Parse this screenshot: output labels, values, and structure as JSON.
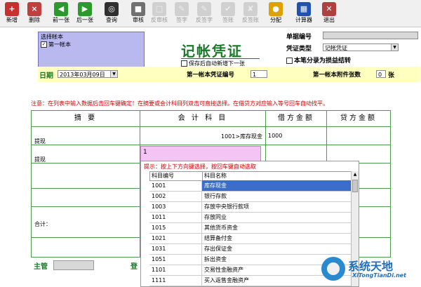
{
  "toolbar": {
    "buttons": [
      {
        "label": "新增",
        "icon": "new-doc-icon",
        "color": "#c83030",
        "enabled": true
      },
      {
        "label": "删除",
        "icon": "delete-icon",
        "color": "#c04040",
        "enabled": true
      },
      {
        "label": "前一张",
        "icon": "arrow-left-icon",
        "color": "#2a9a2a",
        "enabled": true
      },
      {
        "label": "后一张",
        "icon": "arrow-right-icon",
        "color": "#2a9a2a",
        "enabled": true
      },
      {
        "label": "查询",
        "icon": "binoculars-icon",
        "color": "#303030",
        "enabled": true
      },
      {
        "label": "审核",
        "icon": "lock-icon",
        "color": "#707070",
        "enabled": true
      },
      {
        "label": "反审核",
        "icon": "unlock-icon",
        "color": "#c0c0c0",
        "enabled": false
      },
      {
        "label": "签字",
        "icon": "sign-icon",
        "color": "#c0c0c0",
        "enabled": false
      },
      {
        "label": "反签字",
        "icon": "unsign-icon",
        "color": "#c0c0c0",
        "enabled": false
      },
      {
        "label": "签账",
        "icon": "post-icon",
        "color": "#c0c0c0",
        "enabled": false
      },
      {
        "label": "反签账",
        "icon": "unpost-icon",
        "color": "#c0c0c0",
        "enabled": false
      },
      {
        "label": "分配",
        "icon": "pie-icon",
        "color": "#e0a000",
        "enabled": true
      },
      {
        "label": "计算器",
        "icon": "calculator-icon",
        "color": "#2050b0",
        "enabled": true
      },
      {
        "label": "退出",
        "icon": "exit-icon",
        "color": "#b04040",
        "enabled": true
      }
    ]
  },
  "account_box": {
    "title": "选择帐本",
    "item": "第一帐本",
    "checked": "✓"
  },
  "title": "记帐凭证",
  "auto_add_label": "保存后自动新增下一张",
  "doc_number_label": "单据编号",
  "voucher_type_label": "凭证类型",
  "voucher_type_value": "记帐凭证",
  "profit_loss_label": "本笔分录为损益结转",
  "date_label": "日期",
  "date_value": "2013年03月09日",
  "voucher_no_label": "第一帐本凭证编号",
  "voucher_no_value": "1",
  "attachments_label": "第一帐本附件张数",
  "attachments_value": "0",
  "attachments_unit": "张",
  "notice": "注意：在列表中输入数据后击回车键确定！在摘要或会计科目列双击可直接选择。在借贷方对应输入等号回车自动找平。",
  "grid": {
    "headers": [
      "摘  要",
      "会 计 科 目",
      "借方金额",
      "贷方金额"
    ],
    "rows": [
      {
        "summary": "提现",
        "account": "1001>库存现金",
        "debit": "1000"
      },
      {
        "summary": "提现",
        "account_input": "1"
      }
    ],
    "total_label": "合计："
  },
  "popup": {
    "hint": "提示：按上下方向键选择，按回车键自动选取",
    "col_code": "科目编号",
    "col_name": "科目名称",
    "items": [
      {
        "code": "1001",
        "name": "库存现金"
      },
      {
        "code": "1002",
        "name": "银行存款"
      },
      {
        "code": "1003",
        "name": "存放中央银行款项"
      },
      {
        "code": "1011",
        "name": "存放同业"
      },
      {
        "code": "1015",
        "name": "其他货币资金"
      },
      {
        "code": "1021",
        "name": "结算备付金"
      },
      {
        "code": "1031",
        "name": "存出保证金"
      },
      {
        "code": "1051",
        "name": "拆出资金"
      },
      {
        "code": "1101",
        "name": "交易性金融资产"
      },
      {
        "code": "1111",
        "name": "买入返售金融资产"
      }
    ]
  },
  "bottom": {
    "supervisor_label": "主管",
    "register_label": "登"
  },
  "logo": {
    "name": "系统天地",
    "url": "XiTongTianDi.net"
  }
}
